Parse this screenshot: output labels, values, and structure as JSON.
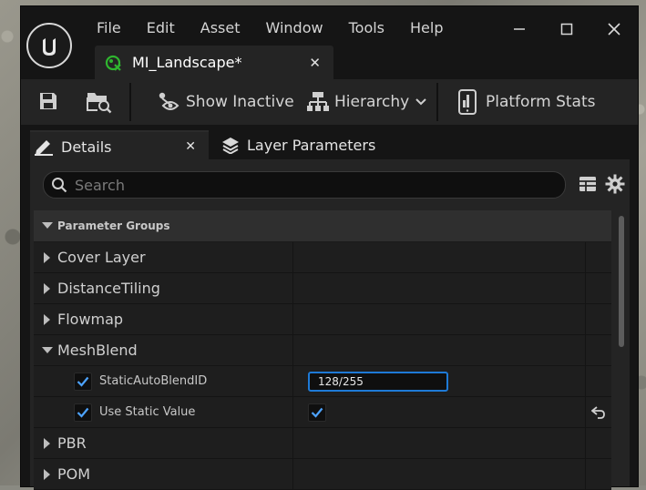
{
  "menu": [
    "File",
    "Edit",
    "Asset",
    "Window",
    "Tools",
    "Help"
  ],
  "document_tab": {
    "label": "MI_Landscape*"
  },
  "toolbar": {
    "show_inactive_label": "Show Inactive",
    "hierarchy_label": "Hierarchy",
    "platform_stats_label": "Platform Stats"
  },
  "panel_tabs": {
    "details_label": "Details",
    "layer_parameters_label": "Layer Parameters"
  },
  "search": {
    "placeholder": "Search"
  },
  "parameter_groups": {
    "header": "Parameter Groups",
    "groups": [
      {
        "label": "Cover Layer",
        "expanded": false
      },
      {
        "label": "DistanceTiling",
        "expanded": false
      },
      {
        "label": "Flowmap",
        "expanded": false
      },
      {
        "label": "MeshBlend",
        "expanded": true
      },
      {
        "label": "PBR",
        "expanded": false
      },
      {
        "label": "POM",
        "expanded": false
      }
    ],
    "meshblend_params": [
      {
        "label": "StaticAutoBlendID",
        "enabled": true,
        "value": "128/255"
      },
      {
        "label": "Use Static Value",
        "enabled": true,
        "checked": true
      }
    ]
  },
  "colors": {
    "accent": "#1e7ad6",
    "checkmark": "#4da3ff",
    "tab_icon": "#2fb52f"
  }
}
